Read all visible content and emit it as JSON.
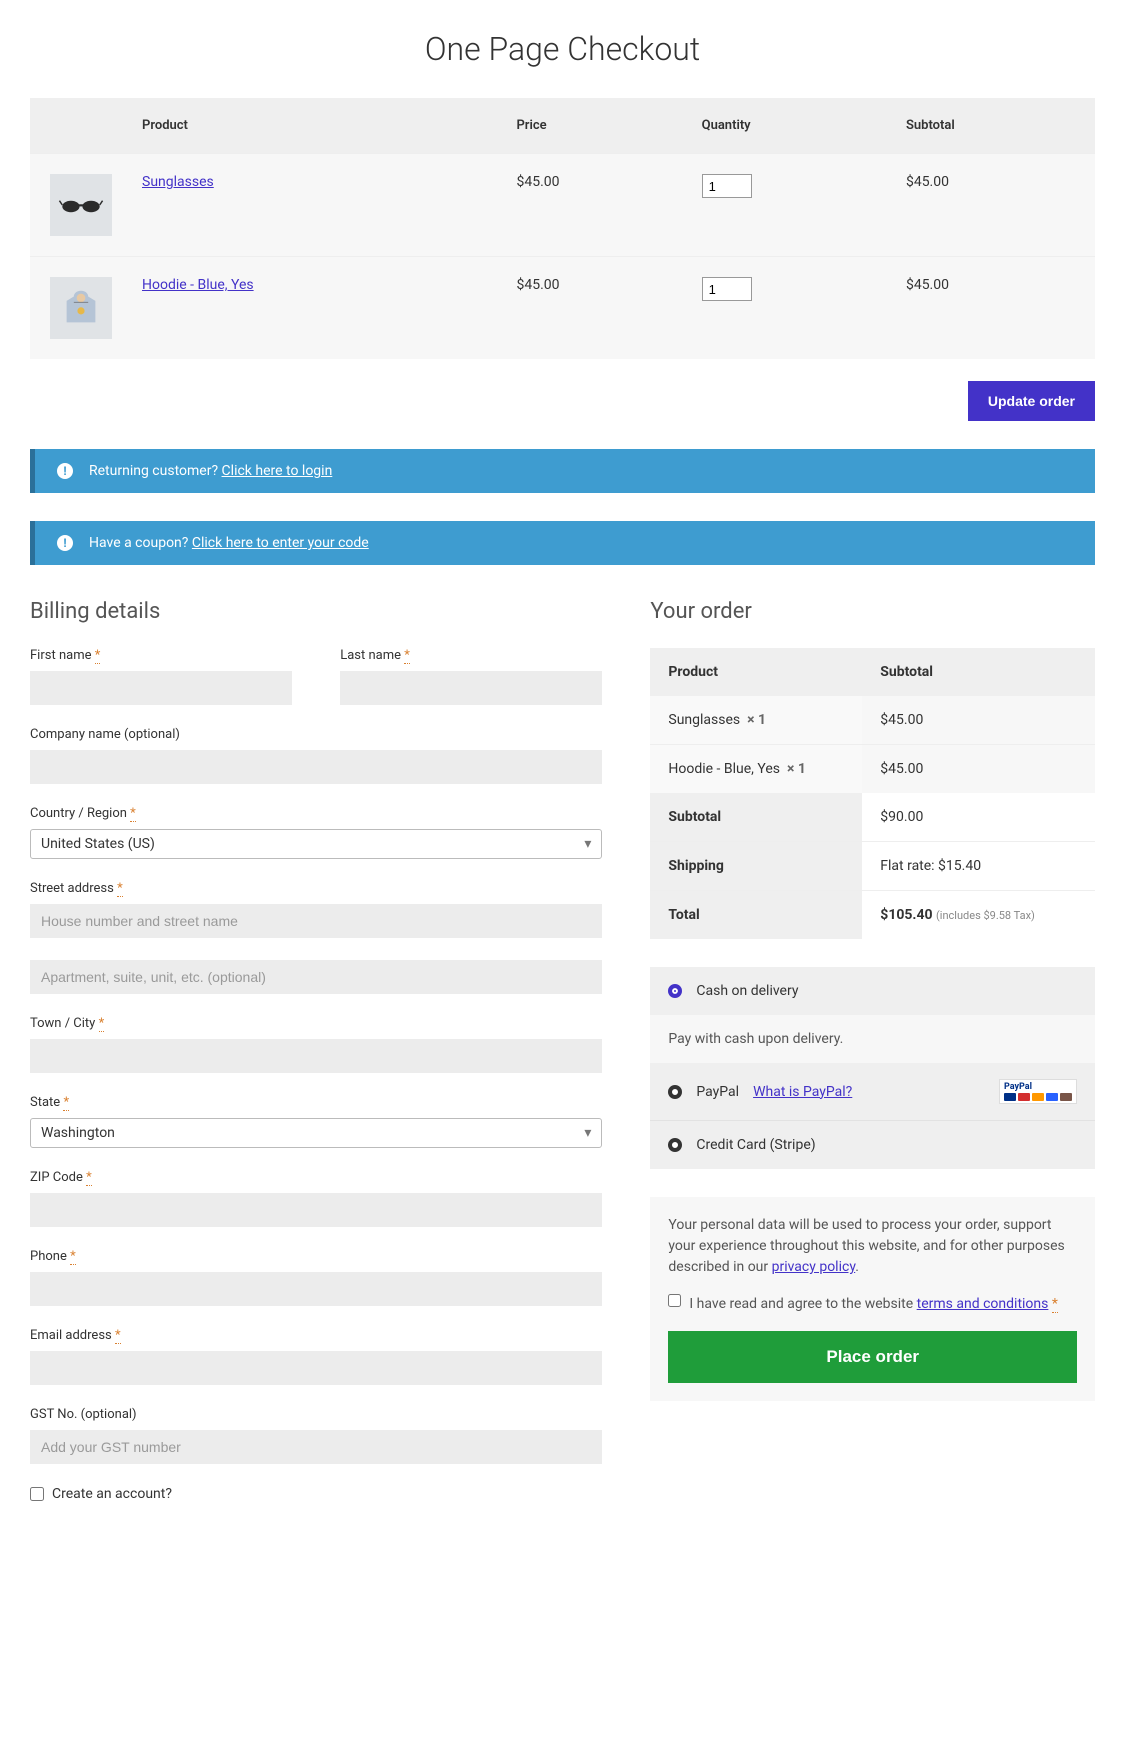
{
  "title": "One Page Checkout",
  "cart": {
    "headers": {
      "product": "Product",
      "price": "Price",
      "quantity": "Quantity",
      "subtotal": "Subtotal"
    },
    "items": [
      {
        "name": "Sunglasses",
        "price": "$45.00",
        "qty": "1",
        "subtotal": "$45.00"
      },
      {
        "name": "Hoodie - Blue, Yes",
        "price": "$45.00",
        "qty": "1",
        "subtotal": "$45.00"
      }
    ],
    "update_button": "Update order"
  },
  "notices": {
    "login_pre": "Returning customer?",
    "login_link": "Click here to login",
    "coupon_pre": "Have a coupon?",
    "coupon_link": "Click here to enter your code"
  },
  "billing": {
    "heading": "Billing details",
    "first_name": "First name",
    "last_name": "Last name",
    "company": "Company name (optional)",
    "country": "Country / Region",
    "country_value": "United States (US)",
    "street": "Street address",
    "street_ph": "House number and street name",
    "street2_ph": "Apartment, suite, unit, etc. (optional)",
    "town": "Town / City",
    "state": "State",
    "state_value": "Washington",
    "zip": "ZIP Code",
    "phone": "Phone",
    "email": "Email address",
    "gst": "GST No. (optional)",
    "gst_ph": "Add your GST number",
    "create_account": "Create an account?",
    "req": "*"
  },
  "order": {
    "heading": "Your order",
    "h_product": "Product",
    "h_subtotal": "Subtotal",
    "lines": [
      {
        "name": "Sunglasses",
        "qty": "× 1",
        "sub": "$45.00"
      },
      {
        "name": "Hoodie - Blue, Yes",
        "qty": "× 1",
        "sub": "$45.00"
      }
    ],
    "subtotal_label": "Subtotal",
    "subtotal_value": "$90.00",
    "shipping_label": "Shipping",
    "shipping_value": "Flat rate: $15.40",
    "total_label": "Total",
    "total_value": "$105.40",
    "tax_note": "(includes $9.58 Tax)"
  },
  "payment": {
    "cod": "Cash on delivery",
    "cod_desc": "Pay with cash upon delivery.",
    "paypal": "PayPal",
    "paypal_link": "What is PayPal?",
    "paypal_brand": "PayPal",
    "stripe": "Credit Card (Stripe)"
  },
  "privacy": {
    "text_pre": "Your personal data will be used to process your order, support your experience throughout this website, and for other purposes described in our ",
    "pp_link": "privacy policy",
    "text_post": ".",
    "terms_pre": "I have read and agree to the website ",
    "terms_link": "terms and conditions",
    "req": "*",
    "place_order": "Place order"
  }
}
